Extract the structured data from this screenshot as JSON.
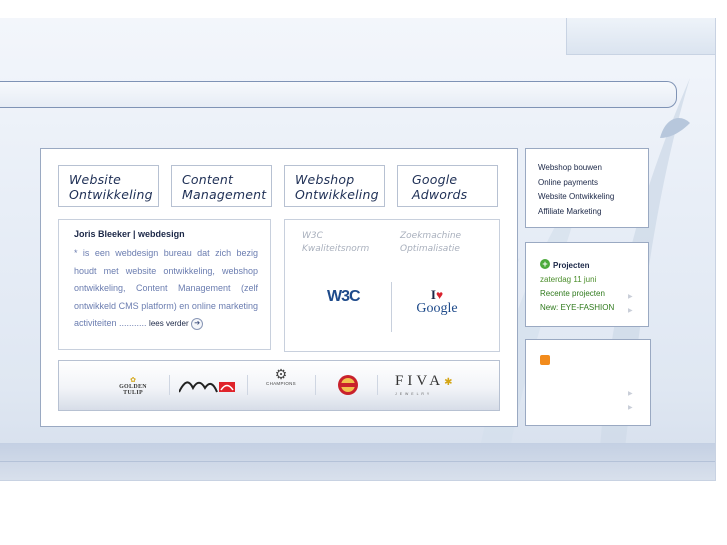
{
  "services": [
    {
      "line1": "Website",
      "line2": "Ontwikkeling"
    },
    {
      "line1": "Content",
      "line2": "Management"
    },
    {
      "line1": "Webshop",
      "line2": "Ontwikkeling"
    },
    {
      "line1": "Google",
      "line2": "Adwords"
    }
  ],
  "about": {
    "title": "Joris Bleeker | webdesign",
    "text": "* is een webdesign bureau dat zich bezig houdt met website ontwikkeling, webshop ontwikkeling, Content Management (zelf ontwikkeld CMS platform) en online marketing activiteiten ...........",
    "read_more": "lees verder"
  },
  "badges": {
    "w3c_label_1": "W3C",
    "w3c_label_2": "Kwaliteitsnorm",
    "seo_label_1": "Zoekmachine",
    "seo_label_2": "Optimalisatie",
    "w3c_logo": "W3C",
    "google_logo_i": "I",
    "google_logo_heart": "♥",
    "google_logo_text": "Google"
  },
  "clients": {
    "golden_tulip": "GOLDEN TULIP",
    "champions": "CHAMPIONS",
    "fiva": "FIVA",
    "fiva_sub": "J E W E L R Y"
  },
  "sidebar_links": [
    "Webshop bouwen",
    "Online payments",
    "Website Ontwikkeling",
    "Affiliate Marketing"
  ],
  "projects": {
    "title": "Projecten",
    "date": "zaterdag 11 juni",
    "link1": "Recente projecten",
    "link2": "New: EYE-FASHION"
  },
  "colors": {
    "accent": "#1b2747",
    "link_blue": "#6b7db0",
    "green": "#4caa3c",
    "rss": "#f28b1c"
  }
}
